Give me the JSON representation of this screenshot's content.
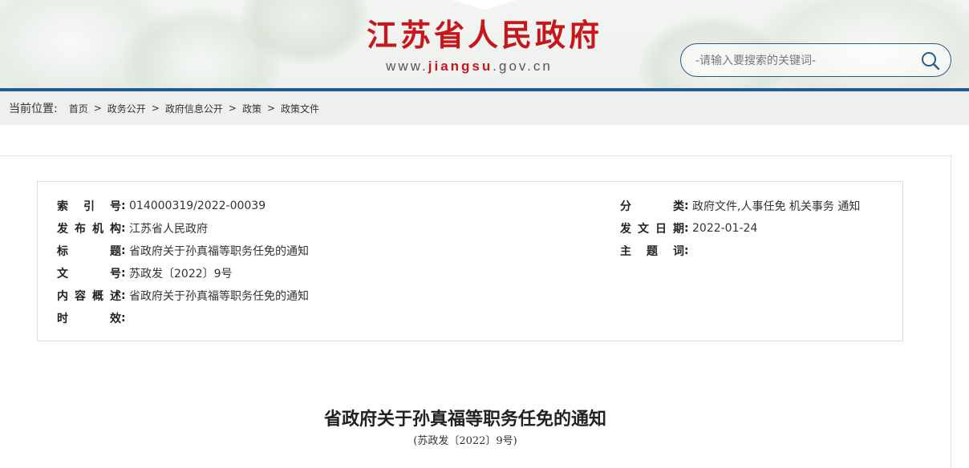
{
  "header": {
    "site_title": "江苏省人民政府",
    "url_prefix": "www.",
    "url_highlight": "jiangsu",
    "url_suffix": ".gov.cn",
    "search_placeholder": "-请输入要搜索的关键词-",
    "brand_red": "#c8161d",
    "brand_blue": "#1f5a98"
  },
  "breadcrumb": {
    "label": "当前位置:",
    "items": [
      "首页",
      "政务公开",
      "政府信息公开",
      "政策",
      "政策文件"
    ],
    "separator": ">"
  },
  "meta": {
    "left": [
      {
        "key": "索引号",
        "value": "014000319/2022-00039"
      },
      {
        "key": "发布机构",
        "value": "江苏省人民政府"
      },
      {
        "key": "标题",
        "value": "省政府关于孙真福等职务任免的通知"
      },
      {
        "key": "文号",
        "value": "苏政发〔2022〕9号"
      },
      {
        "key": "内容概述",
        "value": "省政府关于孙真福等职务任免的通知"
      },
      {
        "key": "时效",
        "value": ""
      }
    ],
    "right": [
      {
        "key": "分类",
        "value": "政府文件,人事任免 机关事务 通知"
      },
      {
        "key": "发文日期",
        "value": "2022-01-24"
      },
      {
        "key": "主题词",
        "value": ""
      }
    ],
    "colon": ":"
  },
  "document": {
    "title": "省政府关于孙真福等职务任免的通知",
    "number": "(苏政发〔2022〕9号)"
  },
  "icons": {
    "search": "search-icon"
  }
}
